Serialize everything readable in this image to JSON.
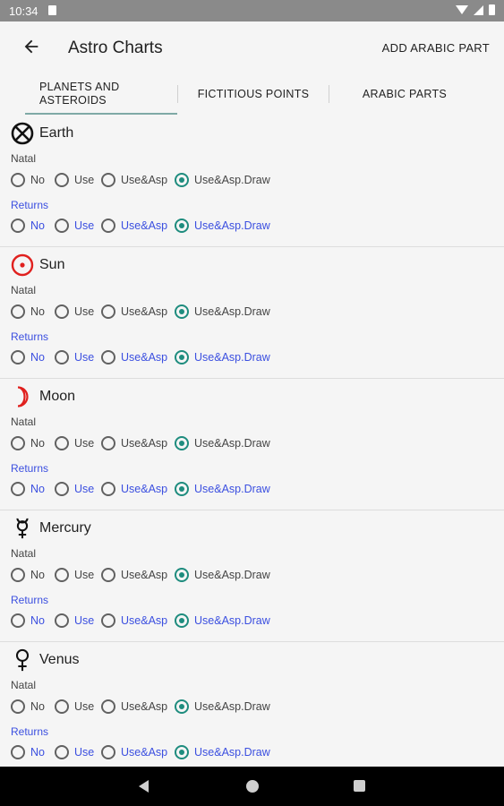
{
  "status_bar": {
    "time": "10:34"
  },
  "app_bar": {
    "title": "Astro Charts",
    "action": "ADD ARABIC PART"
  },
  "tabs": [
    {
      "label": "PLANETS AND ASTEROIDS",
      "line1": "PLANETS AND",
      "line2": "ASTEROIDS",
      "selected": true
    },
    {
      "label": "FICTITIOUS POINTS",
      "selected": false
    },
    {
      "label": "ARABIC PARTS",
      "selected": false
    }
  ],
  "labels": {
    "natal": "Natal",
    "returns": "Returns"
  },
  "options": [
    "No",
    "Use",
    "Use&Asp",
    "Use&Asp.Draw"
  ],
  "planets": [
    {
      "name": "Earth",
      "icon": "earth-symbol-icon",
      "natal_selected": "Use&Asp.Draw",
      "returns_selected": "Use&Asp.Draw"
    },
    {
      "name": "Sun",
      "icon": "sun-symbol-icon",
      "natal_selected": "Use&Asp.Draw",
      "returns_selected": "Use&Asp.Draw"
    },
    {
      "name": "Moon",
      "icon": "moon-symbol-icon",
      "natal_selected": "Use&Asp.Draw",
      "returns_selected": "Use&Asp.Draw"
    },
    {
      "name": "Mercury",
      "icon": "mercury-symbol-icon",
      "natal_selected": "Use&Asp.Draw",
      "returns_selected": "Use&Asp.Draw"
    },
    {
      "name": "Venus",
      "icon": "venus-symbol-icon",
      "natal_selected": "Use&Asp.Draw",
      "returns_selected": "Use&Asp.Draw"
    }
  ],
  "colors": {
    "accent": "#1e8c7e",
    "returns_text": "#3b4fe0",
    "sun_icon": "#e0201e",
    "moon_icon": "#e0201e"
  }
}
